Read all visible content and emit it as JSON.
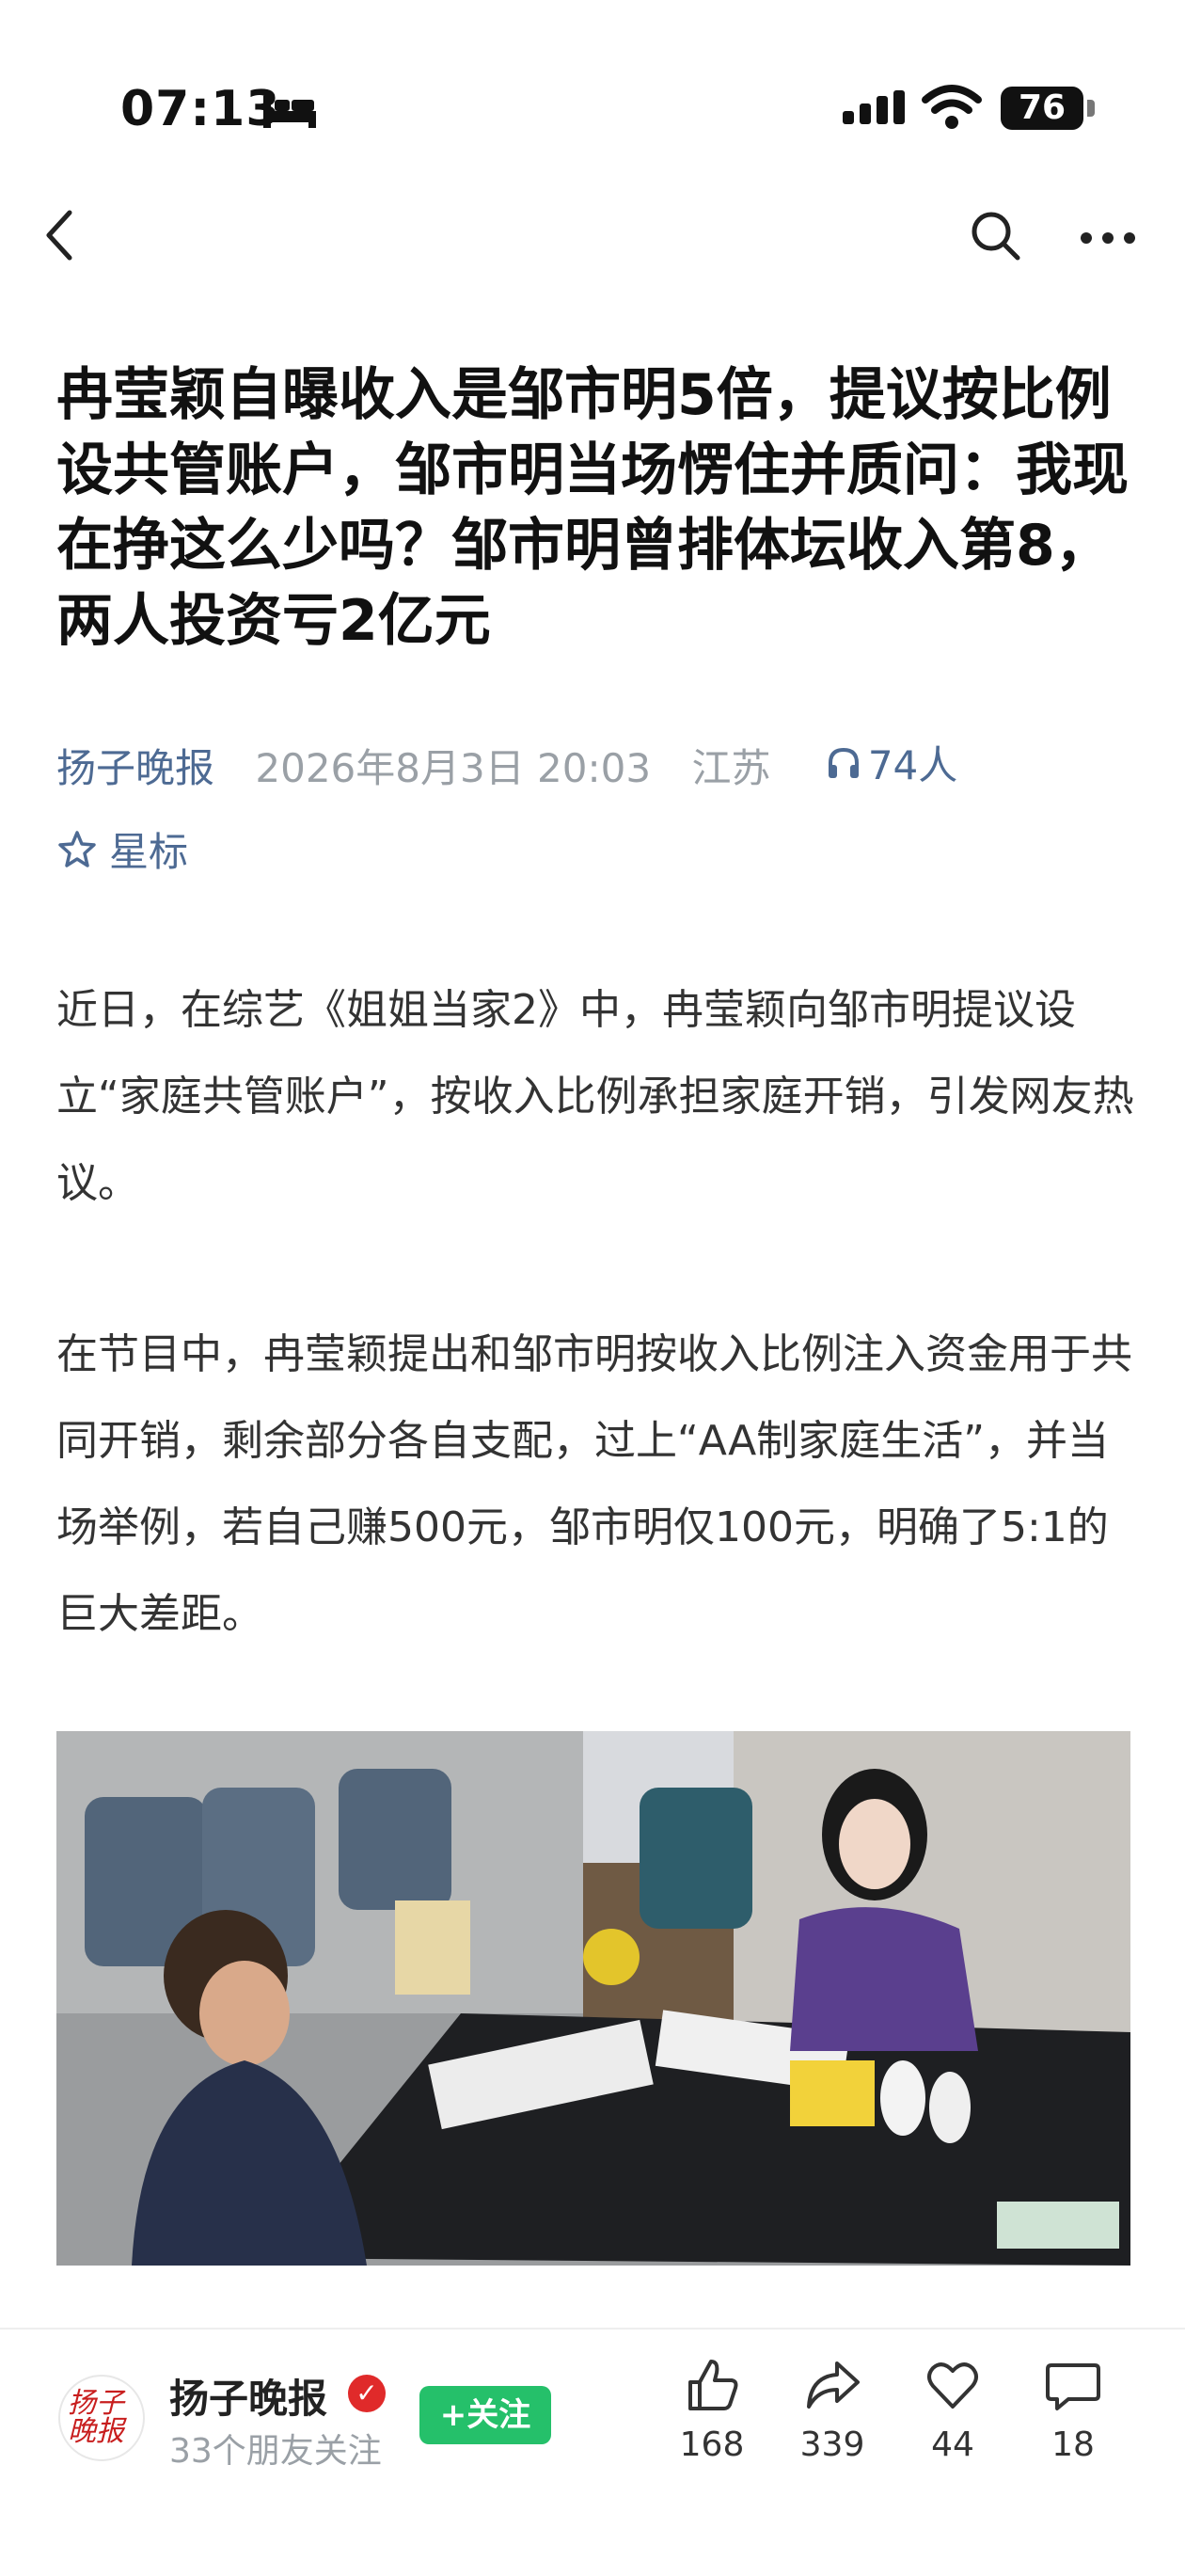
{
  "status_bar": {
    "time": "07:13",
    "battery": "76"
  },
  "article": {
    "title": "冉莹颖自曝收入是邹市明5倍，提议按比例设共管账户，邹市明当场愣住并质问：我现在挣这么少吗？邹市明曾排体坛收入第8，两人投资亏2亿元",
    "source": "扬子晚报",
    "date": "2026年8月3日 20:03",
    "location": "江苏",
    "listeners": "74人",
    "star_label": "星标",
    "paragraphs": [
      "近日，在综艺《姐姐当家2》中，冉莹颖向邹市明提议设立“家庭共管账户”，按收入比例承担家庭开销，引发网友热议。",
      "在节目中，冉莹颖提出和邹市明按收入比例注入资金用于共同开销，剩余部分各自支配，过上“AA制家庭生活”，并当场举例，若自己赚500元，邹市明仅100元，明确了5:1的巨大差距。"
    ]
  },
  "bottom_bar": {
    "account_name": "扬子晚报",
    "avatar_text": "扬子晚报",
    "friends_following": "33个朋友关注",
    "follow_label": "+关注",
    "actions": [
      {
        "icon": "thumbs-up-icon",
        "count": "168"
      },
      {
        "icon": "share-icon",
        "count": "339"
      },
      {
        "icon": "heart-icon",
        "count": "44"
      },
      {
        "icon": "comment-icon",
        "count": "18"
      }
    ]
  },
  "colors": {
    "accent_link": "#4d6a93",
    "follow_green": "#25c06a",
    "verified_red": "#e02a2a"
  }
}
